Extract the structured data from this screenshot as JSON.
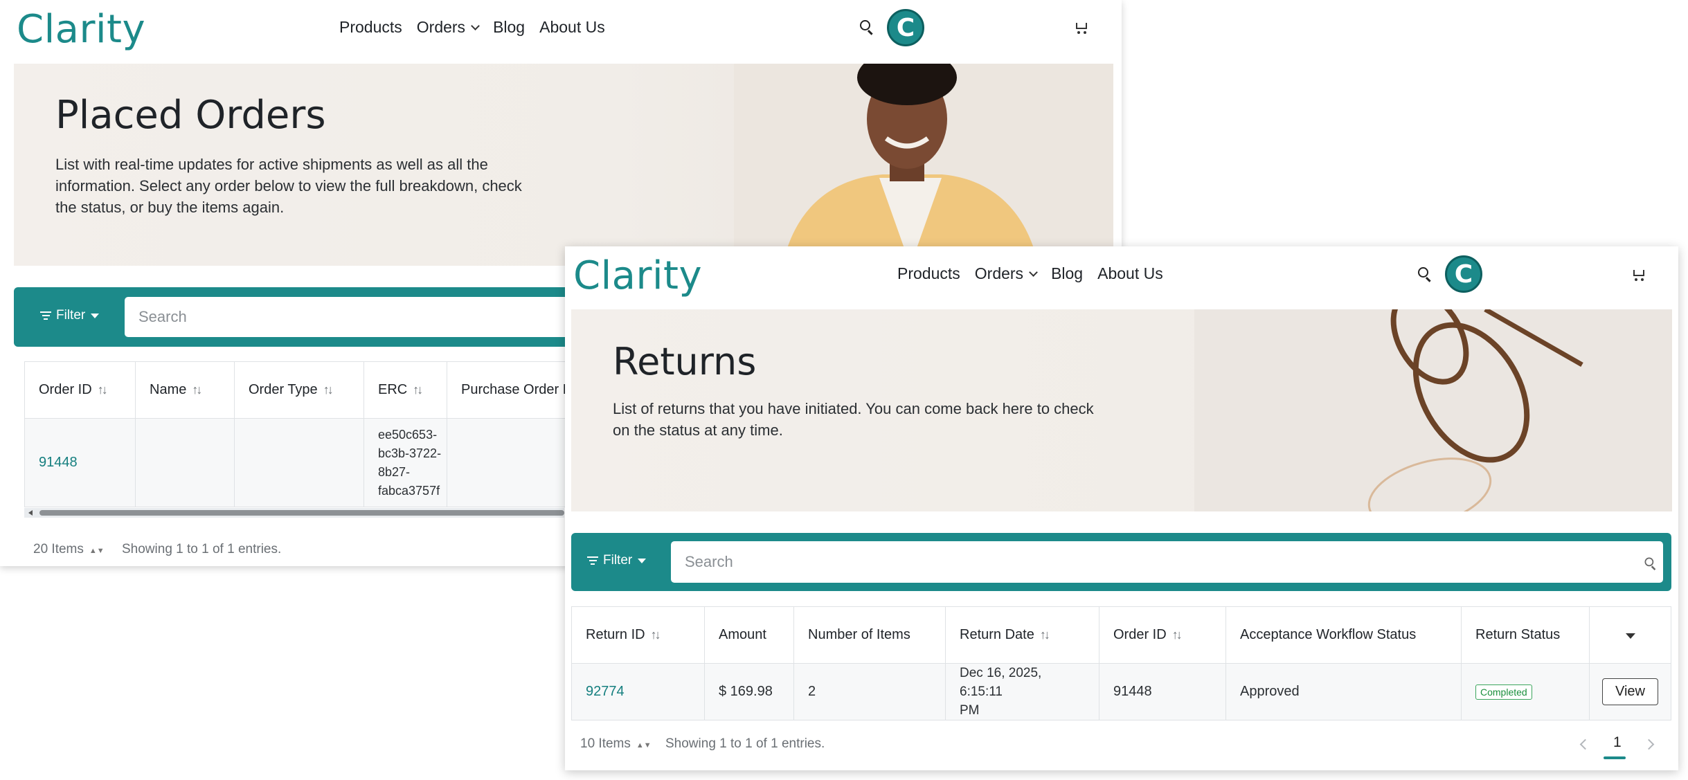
{
  "common": {
    "logo": "Clarity",
    "nav": [
      "Products",
      "Orders",
      "Blog",
      "About Us"
    ],
    "avatar_letter": "C",
    "filter_label": "Filter",
    "search_placeholder": "Search"
  },
  "orders_window": {
    "title": "Placed Orders",
    "description": "List with real-time updates for active shipments as well as all the information. Select any order below to view the full breakdown, check the status, or buy the items again.",
    "columns": [
      "Order ID",
      "Name",
      "Order Type",
      "ERC",
      "Purchase Order N"
    ],
    "rows": [
      {
        "order_id": "91448",
        "name": "",
        "order_type": "",
        "erc": "ee50c653-bc3b-3722-8b27-fabca3757f",
        "purchase_order": ""
      }
    ],
    "erc_lines": [
      "ee50c653-",
      "bc3b-3722-",
      "8b27-",
      "fabca3757f"
    ],
    "page_size": "20 Items",
    "showing": "Showing 1 to 1 of 1 entries."
  },
  "returns_window": {
    "title": "Returns",
    "description": "List of returns that you have initiated.  You can come back here to check on the status at any time.",
    "columns": [
      "Return ID",
      "Amount",
      "Number of Items",
      "Return Date",
      "Order ID",
      "Acceptance Workflow Status",
      "Return Status"
    ],
    "rows": [
      {
        "return_id": "92774",
        "amount": "$ 169.98",
        "items": "2",
        "return_date_l1": "Dec 16, 2025, 6:15:11",
        "return_date_l2": "PM",
        "order_id": "91448",
        "workflow_status": "Approved",
        "return_status": "Completed",
        "action": "View"
      }
    ],
    "page_size": "10 Items",
    "showing": "Showing 1 to 1 of 1 entries.",
    "current_page": "1"
  },
  "colors": {
    "brand_teal": "#1c8a8a",
    "completed_green": "#1a8f3c"
  }
}
